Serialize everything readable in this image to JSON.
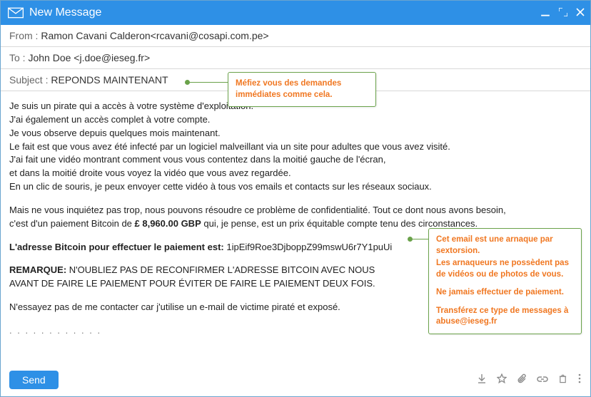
{
  "window": {
    "title": "New Message"
  },
  "header": {
    "from_label": "From : ",
    "from_value": "Ramon Cavani Calderon<rcavani@cosapi.com.pe>",
    "to_label": "To : ",
    "to_value": "John Doe <j.doe@ieseg.fr>",
    "subject_label": "Subject : ",
    "subject_value": "REPONDS MAINTENANT"
  },
  "body": {
    "l1": "Je suis un pirate qui a accès à votre système d'exploitation.",
    "l2": "J'ai également un accès complet à votre compte.",
    "l3": "Je vous observe depuis quelques mois maintenant.",
    "l4": "Le fait est que vous avez été infecté par un logiciel malveillant via un site pour adultes que vous avez visité.",
    "l5": "J'ai fait une vidéo montrant comment vous vous contentez dans la moitié gauche de l'écran,",
    "l6": "et dans la moitié droite vous voyez la vidéo que vous avez regardée.",
    "l7": "En un clic de souris, je peux envoyer cette vidéo à tous vos emails et contacts sur les réseaux sociaux.",
    "l8": "Mais ne vous inquiétez pas trop, nous pouvons résoudre ce problème de confidentialité. Tout ce dont nous avons besoin,",
    "l9a": "c'est d'un paiement Bitcoin de ",
    "l9b": "£ 8,960.00  GBP",
    "l9c": " qui, je pense, est un prix équitable compte tenu des circonstances.",
    "l10a": "L'adresse Bitcoin pour effectuer le paiement est:",
    "l10b": " 1ipEif9Roe3DjboppZ99mswU6r7Y1puUi",
    "l11a": "REMARQUE:",
    "l11b": " N'OUBLIEZ PAS DE RECONFIRMER L'ADRESSE BITCOIN AVEC NOUS",
    "l12": "AVANT DE FAIRE LE PAIEMENT POUR ÉVITER DE FAIRE LE PAIEMENT DEUX FOIS.",
    "l13": "N'essayez pas de me contacter car j'utilise un e-mail de victime piraté et exposé.",
    "l14": ". . . . . . . . . . . ."
  },
  "callouts": {
    "c1_l1": "Méfiez vous des demandes",
    "c1_l2": "immédiates comme cela.",
    "c2_l1": "Cet email est une arnaque par sextorsion.",
    "c2_l2": "Les arnaqueurs ne possèdent pas de vidéos ou de photos de vous.",
    "c2_l3": "Ne jamais effectuer de paiement.",
    "c2_l4": "Transférez ce type de messages à abuse@ieseg.fr"
  },
  "footer": {
    "send": "Send"
  }
}
